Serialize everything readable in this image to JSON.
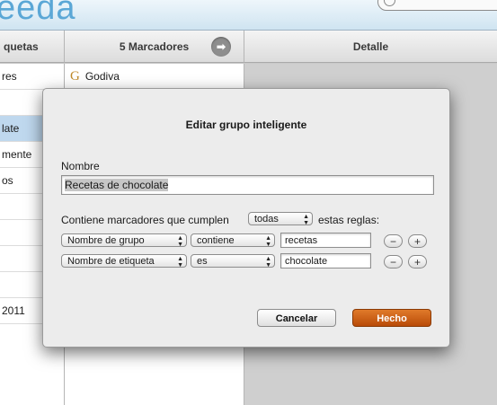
{
  "app": {
    "title": "eeda",
    "title_color": "#5ba7d6"
  },
  "columns": {
    "tags_header": "quetas",
    "bookmarks_header": "5 Marcadores",
    "detail_header": "Detalle"
  },
  "tags": [
    {
      "label": "res",
      "selected": false
    },
    {
      "label": "",
      "selected": false
    },
    {
      "label": "late",
      "selected": true
    },
    {
      "label": "mente",
      "selected": false
    },
    {
      "label": "os",
      "selected": false
    },
    {
      "label": "",
      "selected": false
    },
    {
      "label": "",
      "selected": false
    },
    {
      "label": "",
      "selected": false
    },
    {
      "label": "",
      "selected": false
    },
    {
      "label": "2011",
      "selected": false
    }
  ],
  "bookmarks": [
    {
      "icon": "G",
      "label": "Godiva"
    }
  ],
  "dialog": {
    "title": "Editar grupo inteligente",
    "name_label": "Nombre",
    "name_value": "Recetas de chocolate",
    "match_prefix": "Contiene marcadores que cumplen",
    "match_mode": "todas",
    "match_suffix": "estas reglas:",
    "rules": [
      {
        "field": "Nombre de grupo",
        "operator": "contiene",
        "value": "recetas"
      },
      {
        "field": "Nombre de etiqueta",
        "operator": "es",
        "value": "chocolate"
      }
    ],
    "remove_symbol": "−",
    "add_symbol": "+",
    "cancel_label": "Cancelar",
    "done_label": "Hecho",
    "done_color": "#c9580e"
  }
}
